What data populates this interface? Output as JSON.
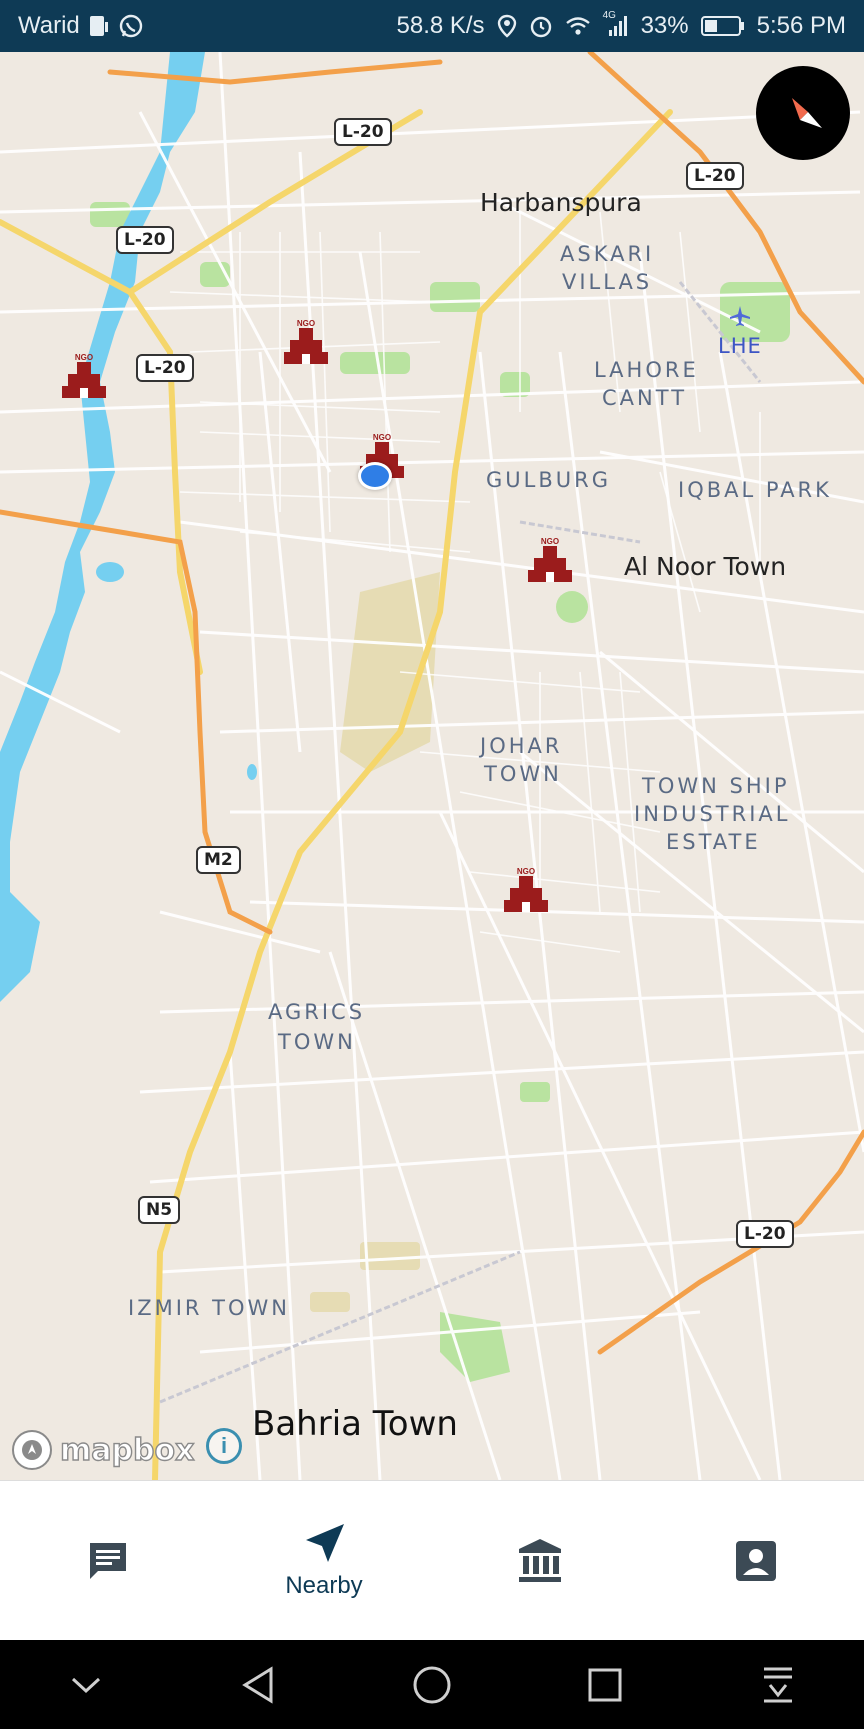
{
  "status_bar": {
    "carrier": "Warid",
    "speed": "58.8 K/s",
    "network_type": "4G",
    "battery": "33%",
    "time": "5:56 PM"
  },
  "map": {
    "places": {
      "harbanspura": "Harbanspura",
      "askari_villas_1": "ASKARI",
      "askari_villas_2": "VILLAS",
      "lahore_cantt_1": "LAHORE",
      "lahore_cantt_2": "CANTT",
      "airport": "LHE",
      "gulburg": "GULBURG",
      "iqbal_park": "IQBAL PARK",
      "al_noor_town": "Al Noor Town",
      "johar_town_1": "JOHAR",
      "johar_town_2": "TOWN",
      "township_1": "TOWN SHIP",
      "township_2": "INDUSTRIAL",
      "township_3": "ESTATE",
      "agrics_1": "AGRICS",
      "agrics_2": "TOWN",
      "izmir_town": "IZMIR TOWN",
      "bahria_town": "Bahria Town"
    },
    "road_shields": {
      "l20_a": "L-20",
      "l20_b": "L-20",
      "l20_c": "L-20",
      "l20_d": "L-20",
      "l20_e": "L-20",
      "m2": "M2",
      "n5": "N5"
    },
    "marker_label": "NGO",
    "attribution": "mapbox",
    "info_symbol": "i",
    "colors": {
      "land": "#efe9e1",
      "water": "#75cff0",
      "park": "#b9e3a0",
      "major_road": "#f5d66b",
      "motorway": "#f3a04a",
      "marker": "#9b1c1c",
      "accent": "#0e3a55"
    }
  },
  "bottom_nav": {
    "items": [
      {
        "id": "messages",
        "label": ""
      },
      {
        "id": "nearby",
        "label": "Nearby"
      },
      {
        "id": "institutions",
        "label": ""
      },
      {
        "id": "profile",
        "label": ""
      }
    ]
  }
}
